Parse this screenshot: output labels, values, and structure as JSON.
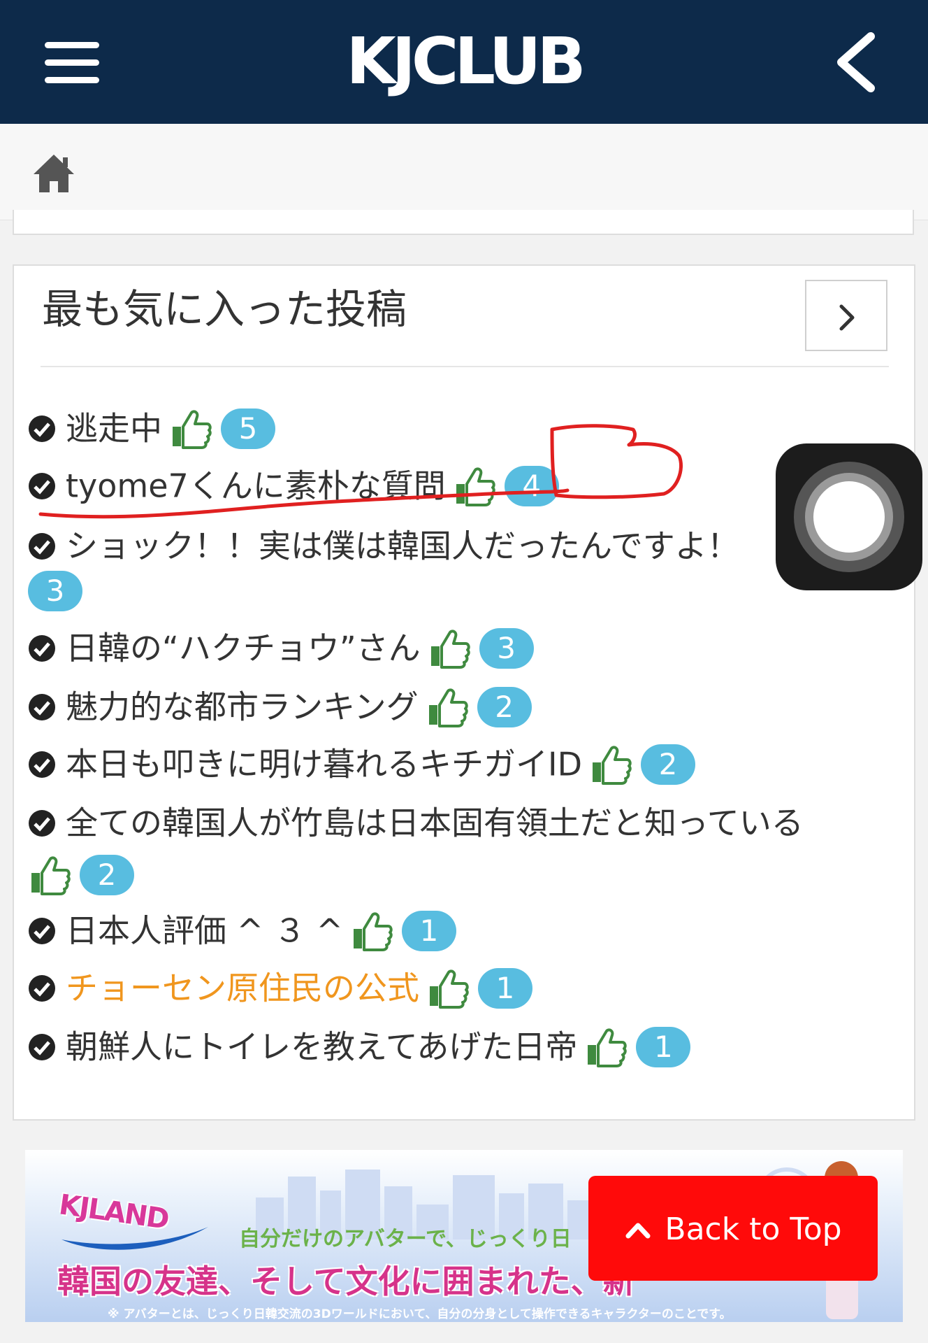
{
  "header": {
    "logo_text": "KJCLUB",
    "menu_icon": "hamburger-menu-icon",
    "back_icon": "chevron-left-icon"
  },
  "breadcrumb": {
    "home_icon": "home-icon"
  },
  "panel": {
    "title": "最も気に入った投稿",
    "more_icon": "chevron-right-icon",
    "posts": [
      {
        "title": "逃走中",
        "count": "5"
      },
      {
        "title": "tyome7くんに素朴な質問",
        "count": "4"
      },
      {
        "title": "ショック！！実は僕は韓国人だったんですよ！",
        "count": "3"
      },
      {
        "title": "日韓の“ハクチョウ”さん",
        "count": "3"
      },
      {
        "title": "魅力的な都市ランキング",
        "count": "2"
      },
      {
        "title": "本日も叩きに明け暮れるキチガイID",
        "count": "2"
      },
      {
        "title": "全ての韓国人が竹島は日本固有領土だと知っている",
        "count": "2"
      },
      {
        "title": "日本人評価 ^ ３ ^",
        "count": "1"
      },
      {
        "title": "チョーセン原住民の公式",
        "count": "1",
        "highlight": true
      },
      {
        "title": "朝鮮人にトイレを教えてあげた日帝",
        "count": "1"
      }
    ]
  },
  "banner": {
    "logo": "KJLAND",
    "tagline": "自分だけのアバターで、じっくり日",
    "headline": "韓国の友達、そして文化に囲まれた、新",
    "note": "※ アバターとは、じっくり日韓交流の3Dワールドにおいて、自分の分身として操作できるキャラクターのことです。"
  },
  "back_to_top": {
    "label": "Back to Top",
    "icon": "chevron-up-icon"
  },
  "colors": {
    "header_bg": "#0d2a4a",
    "badge": "#58bde0",
    "thumb": "#3f8a3f",
    "highlight_text": "#f0961e",
    "back_to_top_bg": "#ff0a0a",
    "annotation": "#e02020"
  }
}
